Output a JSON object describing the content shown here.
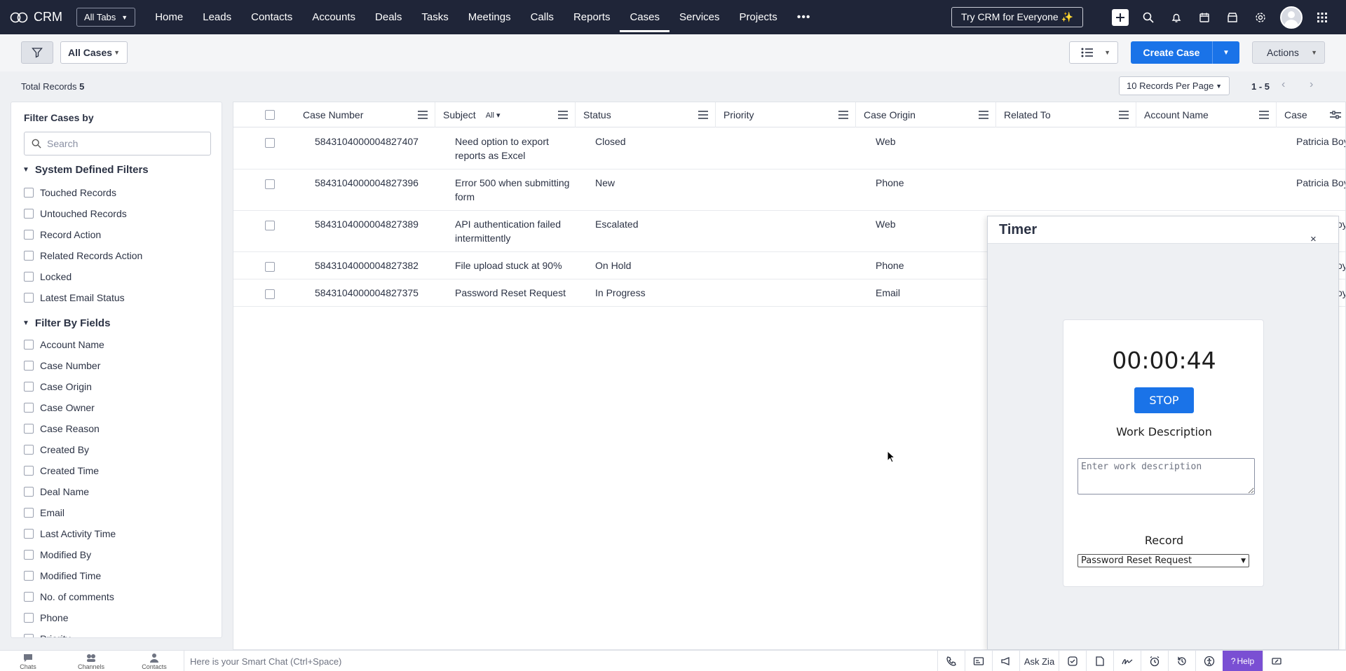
{
  "app": {
    "name": "CRM",
    "all_tabs_label": "All Tabs",
    "try_label": "Try CRM for Everyone ✨"
  },
  "nav": {
    "tabs": [
      "Home",
      "Leads",
      "Contacts",
      "Accounts",
      "Deals",
      "Tasks",
      "Meetings",
      "Calls",
      "Reports",
      "Cases",
      "Services",
      "Projects"
    ],
    "active": "Cases",
    "more_label": "•••"
  },
  "toolbar": {
    "view_label": "All Cases",
    "create_label": "Create Case",
    "actions_label": "Actions"
  },
  "records": {
    "total_label": "Total Records",
    "total_count": "5",
    "per_page": "10 Records Per Page",
    "range": "1 - 5"
  },
  "filters": {
    "title": "Filter Cases by",
    "search_placeholder": "Search",
    "system_title": "System Defined Filters",
    "system_items": [
      "Touched Records",
      "Untouched Records",
      "Record Action",
      "Related Records Action",
      "Locked",
      "Latest Email Status"
    ],
    "fields_title": "Filter By Fields",
    "field_items": [
      "Account Name",
      "Case Number",
      "Case Origin",
      "Case Owner",
      "Case Reason",
      "Created By",
      "Created Time",
      "Deal Name",
      "Email",
      "Last Activity Time",
      "Modified By",
      "Modified Time",
      "No. of comments",
      "Phone",
      "Priority"
    ]
  },
  "table": {
    "columns": [
      "Case Number",
      "Subject",
      "Status",
      "Priority",
      "Case Origin",
      "Related To",
      "Account Name",
      "Case"
    ],
    "subject_filter": "All",
    "rows": [
      {
        "number": "5843104000004827407",
        "subject_line1": "Need option to export",
        "subject_line2": "reports as Excel",
        "status": "Closed",
        "priority": "",
        "origin": "Web",
        "related": "",
        "account": "",
        "owner": "Patricia Boy"
      },
      {
        "number": "5843104000004827396",
        "subject_line1": "Error 500 when submitting",
        "subject_line2": "form",
        "status": "New",
        "priority": "",
        "origin": "Phone",
        "related": "",
        "account": "",
        "owner": "Patricia Boy"
      },
      {
        "number": "5843104000004827389",
        "subject_line1": "API authentication failed",
        "subject_line2": "intermittently",
        "status": "Escalated",
        "priority": "",
        "origin": "Web",
        "related": "",
        "account": "",
        "owner": "oy"
      },
      {
        "number": "5843104000004827382",
        "subject_line1": "File upload stuck at 90%",
        "subject_line2": "",
        "status": "On Hold",
        "priority": "",
        "origin": "Phone",
        "related": "",
        "account": "",
        "owner": "oy"
      },
      {
        "number": "5843104000004827375",
        "subject_line1": "Password Reset Request",
        "subject_line2": "",
        "status": "In Progress",
        "priority": "",
        "origin": "Email",
        "related": "",
        "account": "",
        "owner": "oy"
      }
    ]
  },
  "timer": {
    "title": "Timer",
    "close": "×",
    "time": "00:00:44",
    "stop_label": "STOP",
    "work_label": "Work Description",
    "work_placeholder": "Enter work description",
    "record_label": "Record",
    "record_value": "Password Reset Request"
  },
  "bottombar": {
    "chats": "Chats",
    "channels": "Channels",
    "contacts": "Contacts",
    "smartchat": "Here is your Smart Chat (Ctrl+Space)",
    "askzia": "Ask Zia",
    "help": "Help"
  },
  "colors": {
    "nav_bg": "#1f2538",
    "primary": "#1a73e8",
    "help": "#7a4fd3"
  }
}
